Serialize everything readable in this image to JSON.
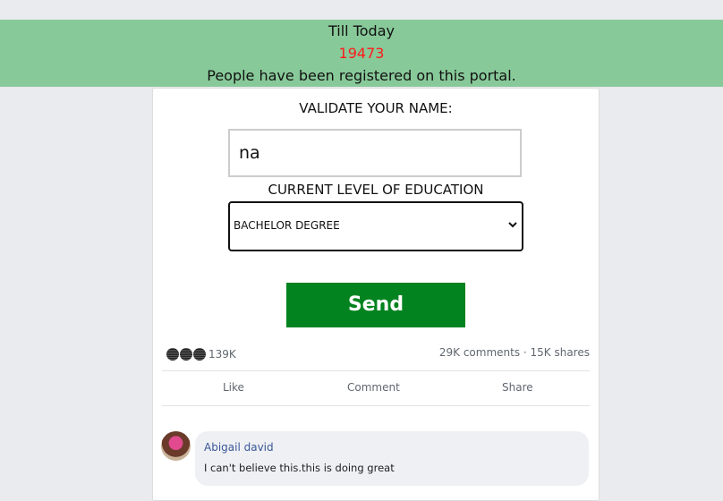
{
  "banner": {
    "line1": "Till Today",
    "count": "19473",
    "line3": "People have been registered on this portal."
  },
  "form": {
    "name_label": "VALIDATE YOUR NAME:",
    "name_value": "na",
    "education_label": "CURRENT LEVEL OF EDUCATION",
    "education_selected": "BACHELOR DEGREE",
    "send_label": "Send"
  },
  "social": {
    "reaction_count": "139K",
    "stats": "29K comments · 15K shares",
    "actions": [
      "Like",
      "Comment",
      "Share"
    ],
    "comment": {
      "author": "Abigail david",
      "text": "I can't believe this.this is doing great"
    }
  },
  "colors": {
    "banner_bg": "#88c999",
    "count_color": "#ff1a1a",
    "send_bg": "#02831f",
    "author_color": "#385898"
  },
  "icons": [
    "reaction-icon",
    "chevron-down-icon",
    "avatar"
  ]
}
